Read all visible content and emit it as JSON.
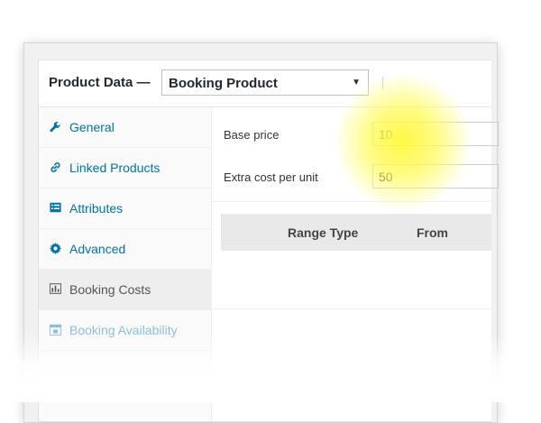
{
  "header": {
    "title": "Product Data —",
    "product_type": {
      "selected": "Booking Product"
    }
  },
  "sidebar": {
    "items": [
      {
        "label": "General",
        "icon": "wrench-icon"
      },
      {
        "label": "Linked Products",
        "icon": "link-icon"
      },
      {
        "label": "Attributes",
        "icon": "list-card-icon"
      },
      {
        "label": "Advanced",
        "icon": "gear-icon"
      },
      {
        "label": "Booking Costs",
        "icon": "chart-icon",
        "active": true
      },
      {
        "label": "Booking Availability",
        "icon": "calendar-icon"
      }
    ]
  },
  "main": {
    "fields": [
      {
        "label": "Base price",
        "value": "10"
      },
      {
        "label": "Extra cost per unit",
        "value": "50"
      }
    ],
    "table": {
      "headers": [
        "Range Type",
        "From"
      ]
    }
  },
  "colors": {
    "link": "#0073aa",
    "highlight": "#fff83c"
  }
}
